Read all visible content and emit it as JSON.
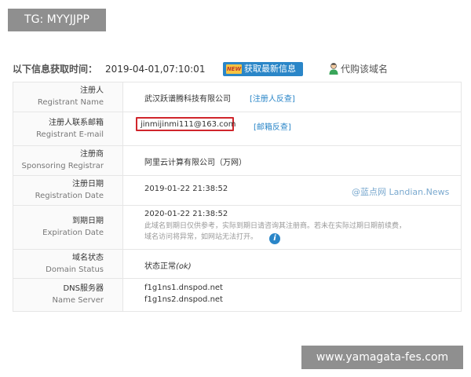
{
  "top_tag": "TG: MYYJJPP",
  "header": {
    "label": "以下信息获取时间：",
    "time": "2019-04-01,07:10:01",
    "refresh_badge": "NEW",
    "refresh_label": "获取最新信息",
    "agent_label": "代购该域名"
  },
  "rows": [
    {
      "cn": "注册人",
      "en": "Registrant Name",
      "value": "武汉跃谱腾科技有限公司",
      "link": "[注册人反查]"
    },
    {
      "cn": "注册人联系邮箱",
      "en": "Registrant E-mail",
      "value": "jinmijinmi111@163.com",
      "link": "[邮箱反查]"
    },
    {
      "cn": "注册商",
      "en": "Sponsoring Registrar",
      "value": "阿里云计算有限公司（万网）"
    },
    {
      "cn": "注册日期",
      "en": "Registration Date",
      "value": "2019-01-22 21:38:52"
    },
    {
      "cn": "到期日期",
      "en": "Expiration Date",
      "value": "2020-01-22 21:38:52",
      "note_line1": "此域名到期日仅供参考，实际到期日请咨询其注册商。若未在实际过期日期前续费，",
      "note_line2": "域名访问将异常，如网站无法打开。"
    },
    {
      "cn": "域名状态",
      "en": "Domain Status",
      "value_prefix": "状态正常",
      "value_code": "(ok)"
    },
    {
      "cn": "DNS服务器",
      "en": "Name Server",
      "value": "f1g1ns1.dnspod.net",
      "value2": "f1g1ns2.dnspod.net"
    }
  ],
  "watermark": "@蓝点网 Landian.News",
  "bottom_tag": "www.yamagata-fes.com",
  "colors": {
    "accent": "#2a86c8",
    "highlight_border": "#d0262c",
    "tag_bg": "#8f8f8f"
  }
}
